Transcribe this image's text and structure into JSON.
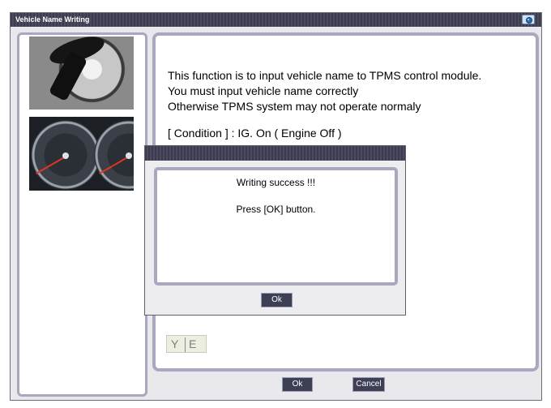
{
  "window": {
    "title": "Vehicle Name Writing",
    "title_icon": "camera-icon"
  },
  "main": {
    "lines": [
      "This function is to input vehicle name to TPMS control module.",
      "You must input vehicle name correctly",
      "Otherwise  TPMS system may not operate normaly",
      "[ Condition ] : IG. On ( Engine Off )"
    ],
    "input": {
      "char1": "Y",
      "char2": "E"
    }
  },
  "buttons": {
    "ok": "Ok",
    "cancel": "Cancel"
  },
  "dialog": {
    "line1": "Writing success !!!",
    "line2": "Press [OK] button.",
    "ok": "Ok"
  },
  "colors": {
    "titlebar": "#3b3c4e",
    "panel_border": "#a8a8bf",
    "button": "#3d3f54",
    "input_bg": "#ecefe0"
  }
}
